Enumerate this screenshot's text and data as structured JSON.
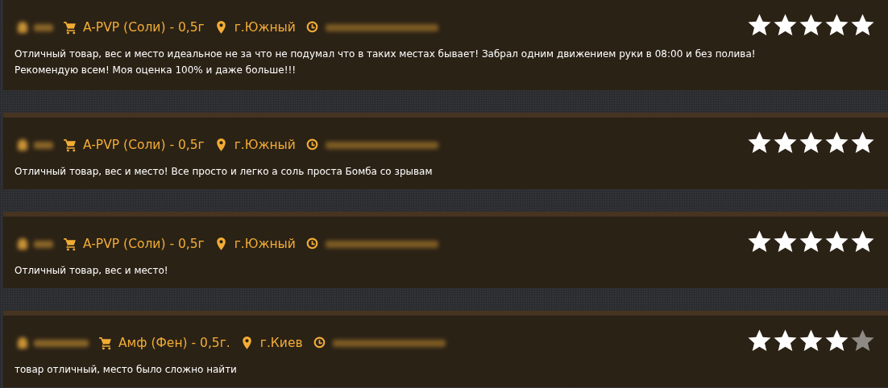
{
  "reviews": [
    {
      "product": "A-PVP (Соли) - 0,5г",
      "city": "г.Южный",
      "text": "Отличный товар, вес и место идеальное не за что не подумал что в таких местах бывает! Забрал одним движением руки в 08:00 и без полива! Рекомендую всем! Моя оценка 100% и даже больше!!!",
      "stars": 5
    },
    {
      "product": "A-PVP (Соли) - 0,5г",
      "city": "г.Южный",
      "text": "Отличный товар, вес и место! Все просто и легко а соль проста Бомба со зрывам",
      "stars": 5
    },
    {
      "product": "A-PVP (Соли) - 0,5г",
      "city": "г.Южный",
      "text": "Отличный товар, вес и место!",
      "stars": 5
    },
    {
      "product": "Амф (Фен) - 0,5г.",
      "city": "г.Киев",
      "text": "товар отличный, место было сложно найти",
      "stars": 4
    }
  ]
}
